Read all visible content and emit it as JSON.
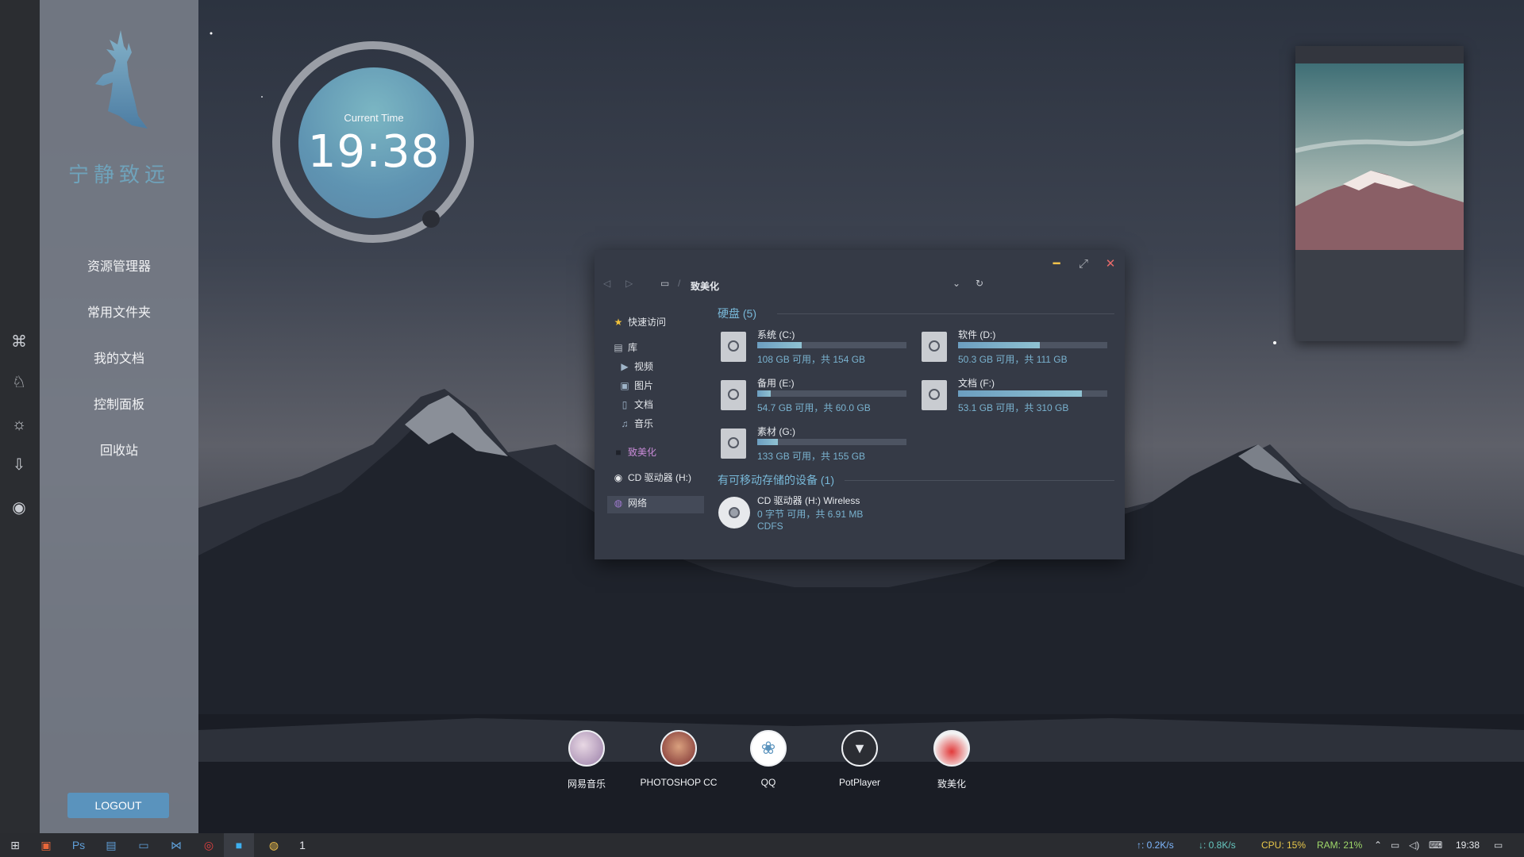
{
  "sidebar": {
    "brand": "宁静致远",
    "menu": [
      "资源管理器",
      "常用文件夹",
      "我的文档",
      "控制面板",
      "回收站"
    ],
    "logout": "LOGOUT"
  },
  "clock": {
    "label": "Current Time",
    "time": "19:38"
  },
  "explorer": {
    "breadcrumb": "致美化",
    "tree": {
      "quick_access": "快速访问",
      "library": "库",
      "videos": "视频",
      "pictures": "图片",
      "documents": "文档",
      "music": "音乐",
      "beautify": "致美化",
      "cd_drive": "CD 驱动器 (H:)",
      "network": "网络"
    },
    "hard_disks_title": "硬盘 (5)",
    "drives": [
      {
        "name": "系统 (C:)",
        "info": "108 GB 可用，共 154 GB",
        "used": 0.3
      },
      {
        "name": "软件 (D:)",
        "info": "50.3 GB 可用，共 111 GB",
        "used": 0.55
      },
      {
        "name": "备用 (E:)",
        "info": "54.7 GB 可用，共 60.0 GB",
        "used": 0.09
      },
      {
        "name": "文档 (F:)",
        "info": "53.1 GB 可用，共 310 GB",
        "used": 0.83
      },
      {
        "name": "素材 (G:)",
        "info": "133 GB 可用，共 155 GB",
        "used": 0.14
      }
    ],
    "removable_title": "有可移动存储的设备 (1)",
    "removable": {
      "name": "CD 驱动器 (H:) Wireless",
      "info": "0 字节 可用，共 6.91 MB",
      "fs": "CDFS"
    }
  },
  "dock": [
    "网易音乐",
    "PHOTOSHOP CC",
    "QQ",
    "PotPlayer",
    "致美化"
  ],
  "taskbar": {
    "upload": "↑: 0.2K/s",
    "download": "↓: 0.8K/s",
    "cpu": "CPU: 15%",
    "ram": "RAM: 21%",
    "time": "19:38"
  },
  "colors": {
    "accent": "#5a93bd",
    "section": "#78b8d8",
    "upload": "#7fb8ff",
    "download": "#66c8c0",
    "cpu": "#e8c84a",
    "ram": "#9fd86a"
  }
}
